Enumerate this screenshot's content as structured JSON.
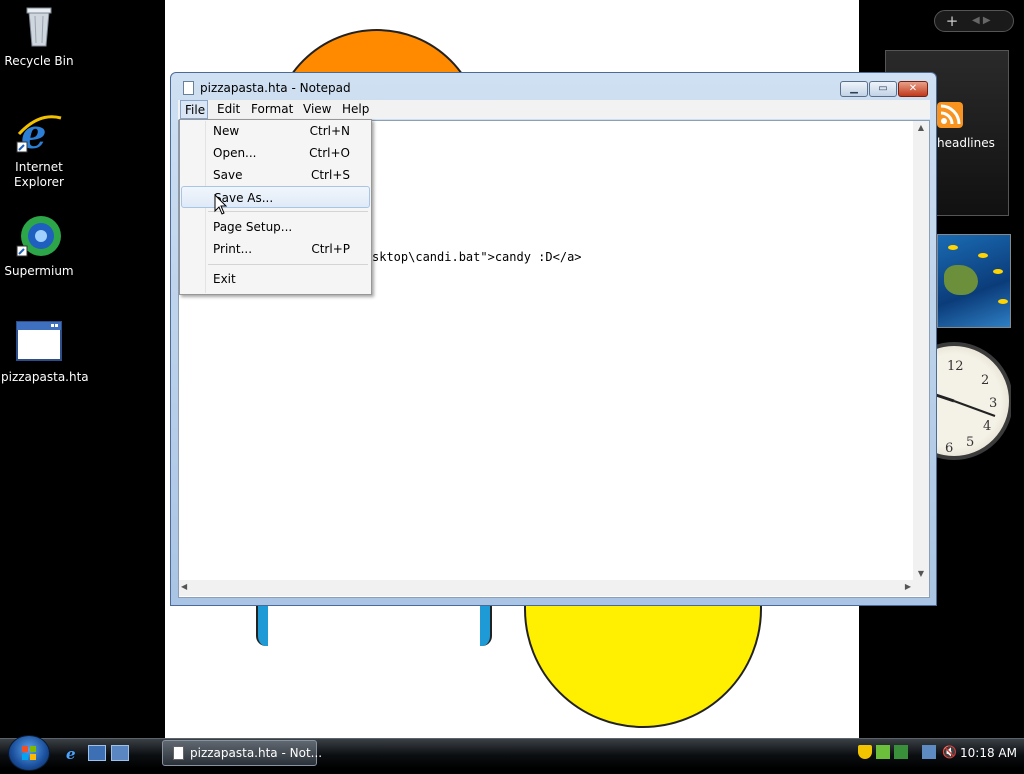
{
  "desktop": {
    "icons": [
      {
        "label": "Recycle Bin"
      },
      {
        "label": "Internet Explorer"
      },
      {
        "label": "Supermium"
      },
      {
        "label": "pizzapasta.hta"
      }
    ]
  },
  "sidebar": {
    "feed_label": "headlines",
    "clock_numbers": [
      "12",
      "2",
      "3",
      "4",
      "5",
      "6"
    ]
  },
  "notepad": {
    "title": "pizzapasta.hta - Notepad",
    "menus": [
      "File",
      "Edit",
      "Format",
      "View",
      "Help"
    ],
    "visible_text": "sktop\\candi.bat\">candy :D</a>",
    "file_menu": [
      {
        "label": "New",
        "shortcut": "Ctrl+N"
      },
      {
        "label": "Open...",
        "shortcut": "Ctrl+O"
      },
      {
        "label": "Save",
        "shortcut": "Ctrl+S"
      },
      {
        "label": "Save As...",
        "shortcut": ""
      },
      {
        "label": "Page Setup...",
        "shortcut": ""
      },
      {
        "label": "Print...",
        "shortcut": "Ctrl+P"
      },
      {
        "label": "Exit",
        "shortcut": ""
      }
    ],
    "highlighted_item": "Save As..."
  },
  "taskbar": {
    "task_label": "pizzapasta.hta - Not...",
    "clock": "10:18 AM"
  },
  "colors": {
    "accent": "#1a4f9c",
    "orange_shape": "#ff8a00",
    "yellow_shape": "#ffef00",
    "blue_shape": "#1e9ad6"
  }
}
